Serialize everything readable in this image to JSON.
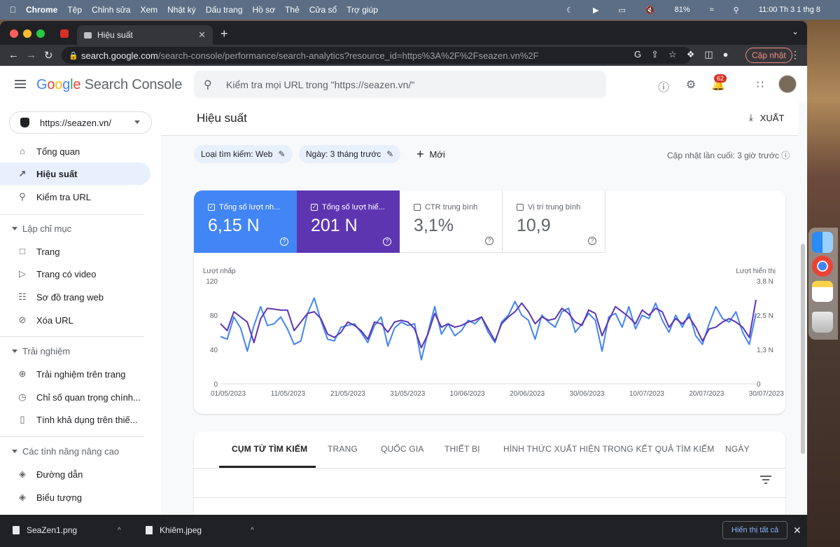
{
  "menubar": {
    "app": "Chrome",
    "items": [
      "Tệp",
      "Chỉnh sửa",
      "Xem",
      "Nhật ký",
      "Dấu trang",
      "Hồ sơ",
      "Thẻ",
      "Cửa sổ",
      "Trợ giúp"
    ],
    "battery": "81%",
    "clock": "11:00 Th 3 1 thg 8"
  },
  "browser": {
    "tab_title": "Hiệu suất",
    "url_host": "search.google.com",
    "url_path": "/search-console/performance/search-analytics?resource_id=https%3A%2F%2Fseazen.vn%2F",
    "update_label": "Cập nhật"
  },
  "header": {
    "product": "Search Console",
    "search_placeholder": "Kiểm tra mọi URL trong \"https://seazen.vn/\"",
    "notif_count": "62"
  },
  "sidebar": {
    "property": "https://seazen.vn/",
    "items": [
      {
        "label": "Tổng quan"
      },
      {
        "label": "Hiệu suất"
      },
      {
        "label": "Kiểm tra URL"
      }
    ],
    "sec1": "Lập chỉ mục",
    "sec1_items": [
      {
        "label": "Trang"
      },
      {
        "label": "Trang có video"
      },
      {
        "label": "Sơ đồ trang web"
      },
      {
        "label": "Xóa URL"
      }
    ],
    "sec2": "Trải nghiệm",
    "sec2_items": [
      {
        "label": "Trải nghiệm trên trang"
      },
      {
        "label": "Chỉ số quan trọng chính..."
      },
      {
        "label": "Tính khả dụng trên thiế..."
      }
    ],
    "sec3": "Các tính năng nâng cao",
    "sec3_items": [
      {
        "label": "Đường dẫn"
      },
      {
        "label": "Biểu tượng"
      }
    ]
  },
  "page": {
    "title": "Hiệu suất",
    "export": "XUẤT",
    "chip1": "Loại tìm kiếm: Web",
    "chip2": "Ngày: 3 tháng trước",
    "new": "Mới",
    "last_update": "Cập nhật lần cuối: 3 giờ trước"
  },
  "metrics": [
    {
      "label": "Tổng số lượt nh...",
      "value": "6,15 N",
      "checked": true
    },
    {
      "label": "Tổng số lượt hiể...",
      "value": "201 N",
      "checked": true
    },
    {
      "label": "CTR trung bình",
      "value": "3,1%",
      "checked": false
    },
    {
      "label": "Vị trí trung bình",
      "value": "10,9",
      "checked": false
    }
  ],
  "tabs": [
    "CỤM TỪ TÌM KIẾM",
    "TRANG",
    "QUỐC GIA",
    "THIẾT BỊ",
    "HÌNH THỨC XUẤT HIỆN TRONG KẾT QUẢ TÌM KIẾM",
    "NGÀY"
  ],
  "downloads": {
    "file1": "SeaZen1.png",
    "file2": "Khiêm.jpeg",
    "show_all": "Hiển thị tất cả"
  },
  "colors": {
    "clicks": "#4285f4",
    "impressions": "#5e35b1"
  },
  "chart_data": {
    "type": "line",
    "x_ticks": [
      "01/05/2023",
      "11/05/2023",
      "21/05/2023",
      "31/05/2023",
      "10/06/2023",
      "20/06/2023",
      "30/06/2023",
      "10/07/2023",
      "20/07/2023",
      "30/07/2023"
    ],
    "ylabel_left": "Lượt nhấp",
    "ylabel_right": "Lượt hiển thị",
    "y_left_ticks": [
      "120",
      "80",
      "40",
      "0"
    ],
    "y_right_ticks": [
      "3,8 N",
      "2,5 N",
      "1,3 N",
      "0"
    ],
    "ylim_left": [
      0,
      120
    ],
    "series": [
      {
        "name": "Lượt nhấp",
        "axis": "left",
        "color": "#4285f4",
        "values": [
          55,
          52,
          78,
          65,
          38,
          68,
          90,
          68,
          70,
          78,
          64,
          46,
          50,
          82,
          100,
          74,
          52,
          50,
          66,
          68,
          70,
          60,
          48,
          68,
          78,
          44,
          65,
          72,
          68,
          70,
          28,
          60,
          90,
          58,
          70,
          56,
          62,
          74,
          70,
          78,
          60,
          48,
          72,
          80,
          96,
          80,
          74,
          52,
          80,
          72,
          66,
          84,
          88,
          60,
          70,
          82,
          74,
          38,
          78,
          82,
          66,
          90,
          64,
          80,
          76,
          94,
          74,
          60,
          80,
          66,
          82,
          56,
          46,
          70,
          90,
          76,
          72,
          84,
          60,
          46,
          82
        ]
      },
      {
        "name": "Lượt hiển thị",
        "axis": "left",
        "color": "#5e35b1",
        "values": [
          70,
          62,
          84,
          78,
          72,
          48,
          76,
          88,
          87,
          86,
          86,
          62,
          72,
          82,
          84,
          76,
          58,
          54,
          60,
          72,
          68,
          62,
          52,
          72,
          70,
          60,
          72,
          74,
          72,
          64,
          42,
          58,
          82,
          66,
          70,
          66,
          68,
          72,
          74,
          78,
          64,
          50,
          70,
          78,
          84,
          94,
          84,
          70,
          78,
          74,
          76,
          88,
          82,
          72,
          68,
          86,
          82,
          56,
          74,
          90,
          84,
          78,
          70,
          86,
          80,
          88,
          84,
          66,
          76,
          70,
          78,
          66,
          50,
          64,
          66,
          72,
          76,
          72,
          66,
          54,
          98
        ]
      }
    ]
  }
}
